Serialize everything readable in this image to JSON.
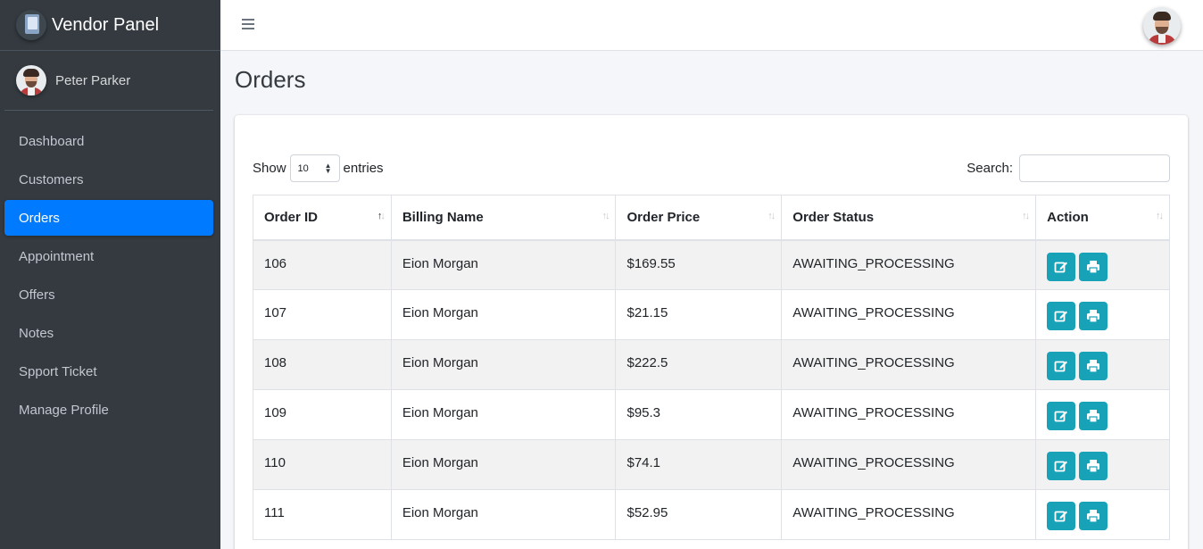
{
  "brand": {
    "title": "Vendor Panel"
  },
  "user": {
    "name": "Peter Parker"
  },
  "sidebar": {
    "items": [
      {
        "label": "Dashboard",
        "active": false
      },
      {
        "label": "Customers",
        "active": false
      },
      {
        "label": "Orders",
        "active": true
      },
      {
        "label": "Appointment",
        "active": false
      },
      {
        "label": "Offers",
        "active": false
      },
      {
        "label": "Notes",
        "active": false
      },
      {
        "label": "Spport Ticket",
        "active": false
      },
      {
        "label": "Manage Profile",
        "active": false
      }
    ]
  },
  "page": {
    "title": "Orders"
  },
  "table_controls": {
    "show_label": "Show",
    "entries_value": "10",
    "entries_label": "entries",
    "search_label": "Search:",
    "search_value": ""
  },
  "table": {
    "columns": [
      "Order ID",
      "Billing Name",
      "Order Price",
      "Order Status",
      "Action"
    ],
    "rows": [
      {
        "id": "106",
        "name": "Eion Morgan",
        "price": "$169.55",
        "status": "AWAITING_PROCESSING"
      },
      {
        "id": "107",
        "name": "Eion Morgan",
        "price": "$21.15",
        "status": "AWAITING_PROCESSING"
      },
      {
        "id": "108",
        "name": "Eion Morgan",
        "price": "$222.5",
        "status": "AWAITING_PROCESSING"
      },
      {
        "id": "109",
        "name": "Eion Morgan",
        "price": "$95.3",
        "status": "AWAITING_PROCESSING"
      },
      {
        "id": "110",
        "name": "Eion Morgan",
        "price": "$74.1",
        "status": "AWAITING_PROCESSING"
      },
      {
        "id": "111",
        "name": "Eion Morgan",
        "price": "$52.95",
        "status": "AWAITING_PROCESSING"
      }
    ],
    "action_icons": [
      "edit-icon",
      "print-icon"
    ]
  },
  "colors": {
    "sidebar_bg": "#343a40",
    "active_nav": "#007bff",
    "action_button": "#17a2b8",
    "content_bg": "#f4f6f9"
  }
}
